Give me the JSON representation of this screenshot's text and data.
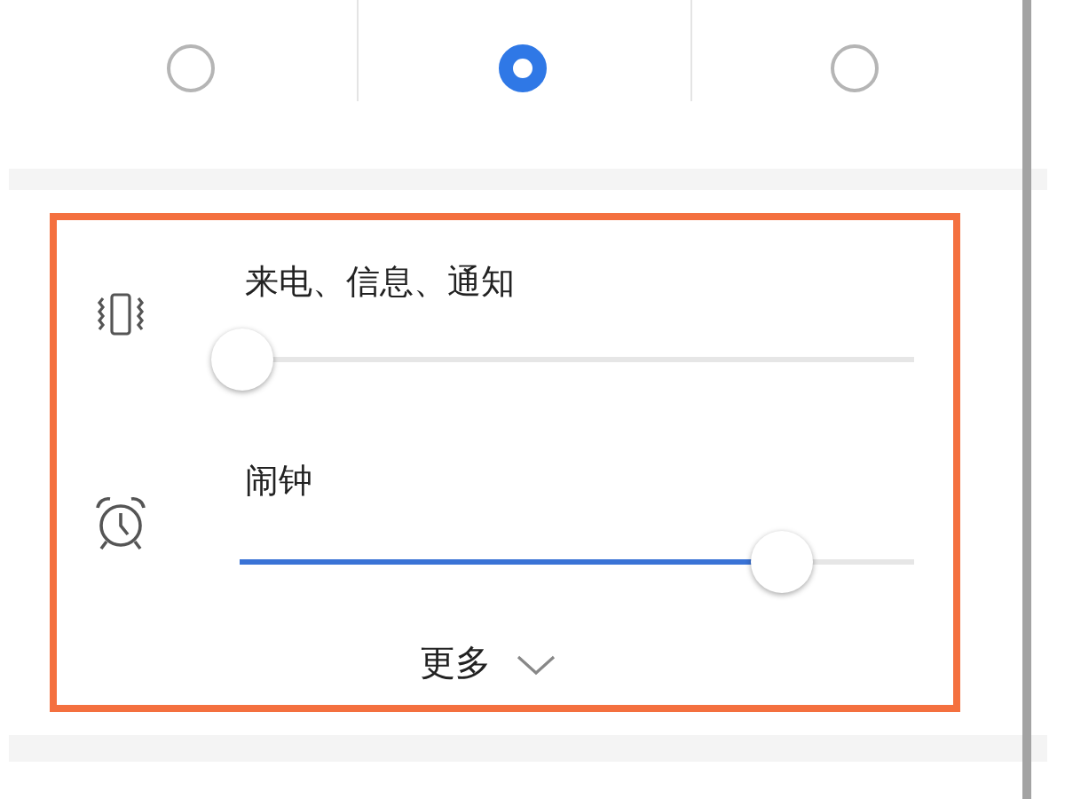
{
  "mode_options": [
    {
      "selected": false
    },
    {
      "selected": true
    },
    {
      "selected": false
    }
  ],
  "volume_sliders": [
    {
      "kind": "vibrate",
      "label": "来电、信息、通知",
      "level": 0
    },
    {
      "kind": "alarm",
      "label": "闹钟",
      "level": 0.8
    }
  ],
  "more_button": {
    "label": "更多"
  }
}
